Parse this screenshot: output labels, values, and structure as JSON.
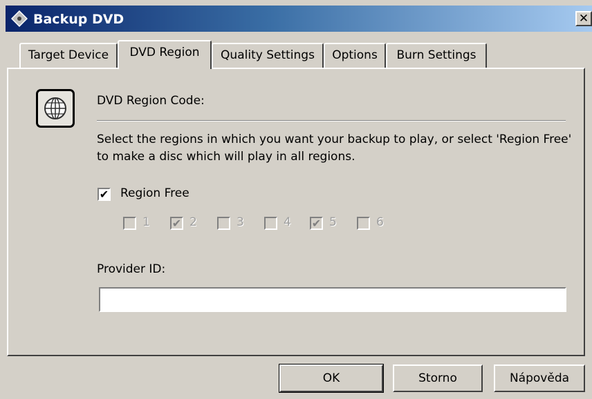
{
  "window": {
    "title": "Backup DVD",
    "close_glyph": "✕",
    "icon": "dvd-disc-icon"
  },
  "tabs": [
    {
      "label": "Target Device",
      "active": false
    },
    {
      "label": "DVD Region",
      "active": true
    },
    {
      "label": "Quality Settings",
      "active": false
    },
    {
      "label": "Options",
      "active": false
    },
    {
      "label": "Burn Settings",
      "active": false
    }
  ],
  "panel": {
    "icon": "globe-icon",
    "heading": "DVD Region Code:",
    "description": "Select the regions in which you want your backup to play, or select 'Region Free' to make a disc which will play in all regions.",
    "region_free": {
      "label": "Region Free",
      "checked": true
    },
    "regions": [
      {
        "label": "1",
        "checked": false,
        "enabled": false
      },
      {
        "label": "2",
        "checked": true,
        "enabled": false
      },
      {
        "label": "3",
        "checked": false,
        "enabled": false
      },
      {
        "label": "4",
        "checked": false,
        "enabled": false
      },
      {
        "label": "5",
        "checked": true,
        "enabled": false
      },
      {
        "label": "6",
        "checked": false,
        "enabled": false
      }
    ],
    "provider_id": {
      "label": "Provider ID:",
      "value": ""
    }
  },
  "buttons": {
    "ok": "OK",
    "cancel": "Storno",
    "help": "Nápověda"
  },
  "check_glyph": "✔",
  "colors": {
    "title_start": "#0a246a",
    "title_end": "#a6caf0",
    "face": "#d4d0c8"
  }
}
